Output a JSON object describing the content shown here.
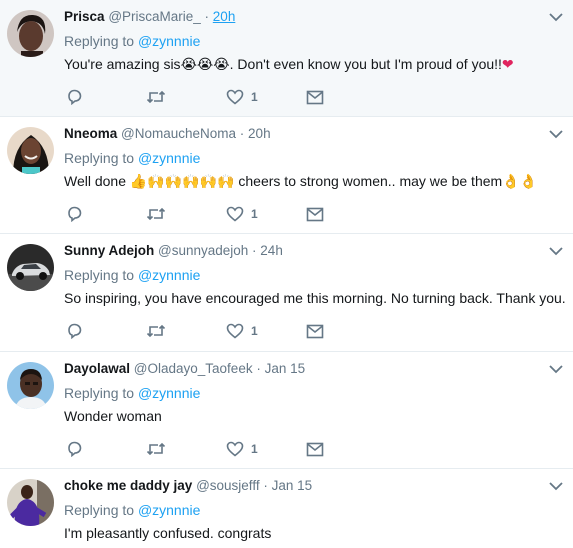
{
  "tweets": [
    {
      "name": "Prisca",
      "handle": "@PriscaMarie_",
      "sep": " · ",
      "time": "20h",
      "replying_prefix": "Replying to ",
      "replying_to": "@zynnnie",
      "text": "You're amazing sis",
      "emoji": "😭😭😭",
      "text_after": ". Don't even know you but I'm proud of you!!",
      "emoji_end": "❤",
      "likes": "1",
      "avatar_icon": "woman-portrait-icon"
    },
    {
      "name": "Nneoma",
      "handle": "@NomaucheNoma",
      "sep": " · ",
      "time": "20h",
      "replying_prefix": "Replying to ",
      "replying_to": "@zynnnie",
      "text": "Well done ",
      "emoji": "👍🙌🙌🙌🙌🙌",
      "text_after": " cheers to strong women.. may we be them",
      "emoji_end": "👌👌",
      "likes": "1",
      "avatar_icon": "woman-smiling-portrait-icon"
    },
    {
      "name": "Sunny Adejoh",
      "handle": "@sunnyadejoh",
      "sep": " · ",
      "time": "24h",
      "replying_prefix": "Replying to ",
      "replying_to": "@zynnnie",
      "text": "So inspiring, you have encouraged me this morning. No turning back. Thank you.",
      "likes": "1",
      "avatar_icon": "car-icon"
    },
    {
      "name": "Dayolawal",
      "handle": "@Oladayo_Taofeek",
      "sep": " · ",
      "time": "Jan 15",
      "replying_prefix": "Replying to ",
      "replying_to": "@zynnnie",
      "text": "Wonder woman",
      "likes": "1",
      "avatar_icon": "man-portrait-icon"
    },
    {
      "name": "choke me daddy jay",
      "handle": "@sousjefff",
      "sep": " · ",
      "time": "Jan 15",
      "replying_prefix": "Replying to ",
      "replying_to": "@zynnnie",
      "text": "I'm pleasantly confused. congrats",
      "avatar_icon": "person-purple-outfit-icon"
    }
  ],
  "icons": {
    "reply": "reply-icon",
    "retweet": "retweet-icon",
    "like": "heart-icon",
    "dm": "envelope-icon",
    "more": "chevron-down-icon"
  },
  "colors": {
    "link": "#1da1f2",
    "muted": "#657786",
    "text": "#14171a",
    "highlight_bg": "#f5f8fa",
    "heart": "#e0245e"
  }
}
